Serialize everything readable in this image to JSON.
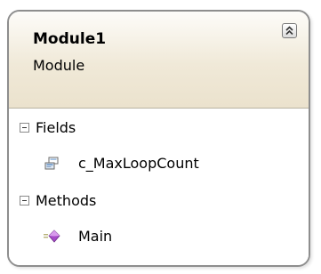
{
  "class_box": {
    "title": "Module1",
    "subtitle": "Module",
    "collapse_icon": "double-chevron-up-icon",
    "sections": [
      {
        "label": "Fields",
        "toggle_icon": "collapse-minus-icon",
        "items": [
          {
            "label": "c_MaxLoopCount",
            "icon": "field-icon"
          }
        ]
      },
      {
        "label": "Methods",
        "toggle_icon": "collapse-minus-icon",
        "items": [
          {
            "label": "Main",
            "icon": "method-icon"
          }
        ]
      }
    ]
  }
}
